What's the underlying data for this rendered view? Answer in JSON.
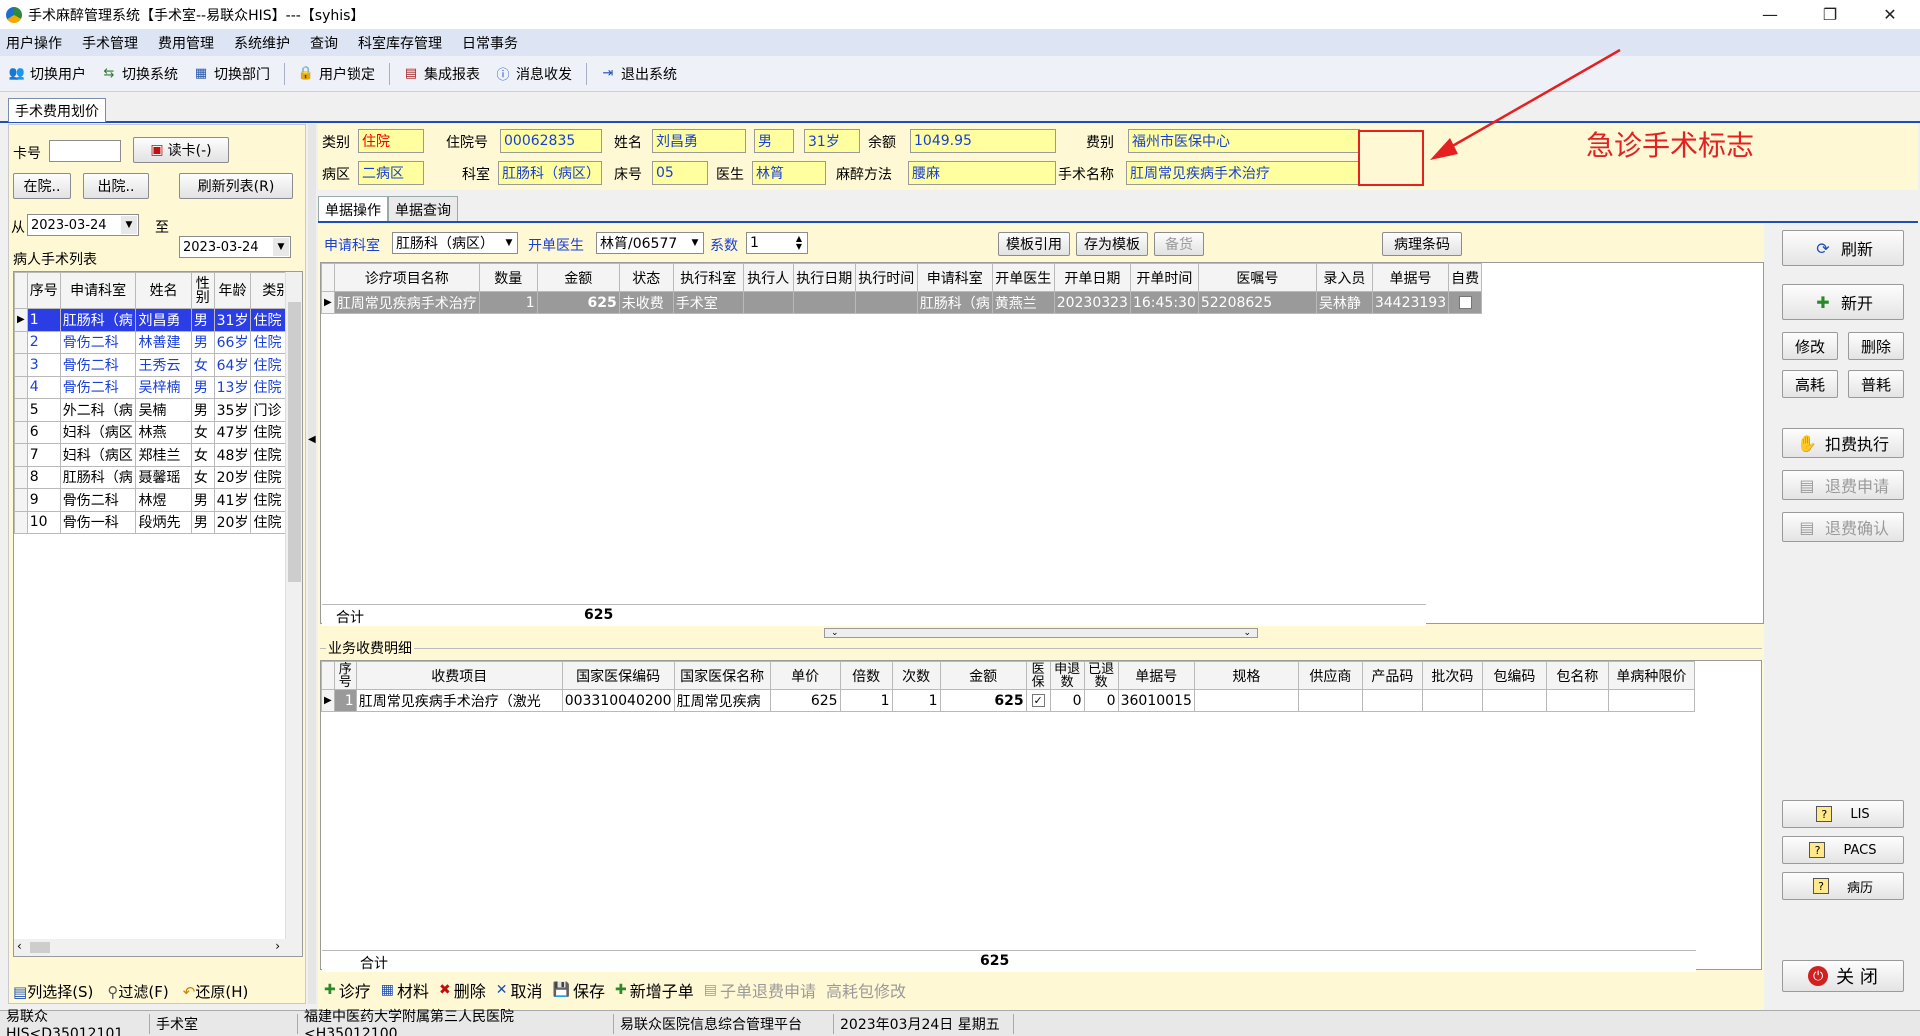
{
  "window": {
    "title": "手术麻醉管理系统【手术室--易联众HIS】---【syhis】",
    "controls": [
      "—",
      "❐",
      "✕"
    ]
  },
  "menu": [
    "用户操作",
    "手术管理",
    "费用管理",
    "系统维护",
    "查询",
    "科室库存管理",
    "日常事务"
  ],
  "toolbar": [
    {
      "label": "切换用户",
      "icon": "users-icon"
    },
    {
      "label": "切换系统",
      "icon": "switch-icon"
    },
    {
      "label": "切换部门",
      "icon": "department-icon"
    },
    {
      "label": "用户锁定",
      "icon": "lock-user-icon"
    },
    {
      "label": "集成报表",
      "icon": "report-icon"
    },
    {
      "label": "消息收发",
      "icon": "info-icon"
    },
    {
      "label": "退出系统",
      "icon": "exit-icon"
    }
  ],
  "module_tab": "手术费用划价",
  "left": {
    "card_label": "卡号",
    "card_value": "",
    "read_card": "读卡(-)",
    "btn_inhosp": "在院..",
    "btn_discharged": "出院..",
    "btn_refresh_list": "刷新列表(R)",
    "from_label": "从",
    "to_label": "至",
    "date_from": "2023-03-24",
    "date_to": "2023-03-24",
    "list_title": "病人手术列表",
    "columns": [
      "序号",
      "申请科室",
      "姓名",
      "性别",
      "年龄",
      "类别"
    ],
    "rows": [
      [
        "1",
        "肛肠科（病",
        "刘昌勇",
        "男",
        "31岁",
        "住院"
      ],
      [
        "2",
        "骨伤二科",
        "林善建",
        "男",
        "66岁",
        "住院"
      ],
      [
        "3",
        "骨伤二科",
        "王秀云",
        "女",
        "64岁",
        "住院"
      ],
      [
        "4",
        "骨伤二科",
        "吴梓楠",
        "男",
        "13岁",
        "住院"
      ],
      [
        "5",
        "外二科（病",
        "吴楠",
        "男",
        "35岁",
        "门诊"
      ],
      [
        "6",
        "妇科（病区",
        "林燕",
        "女",
        "47岁",
        "住院"
      ],
      [
        "7",
        "妇科（病区",
        "郑桂兰",
        "女",
        "48岁",
        "住院"
      ],
      [
        "8",
        "肛肠科（病",
        "聂馨瑶",
        "女",
        "20岁",
        "住院"
      ],
      [
        "9",
        "骨伤二科",
        "林煜",
        "男",
        "41岁",
        "住院"
      ],
      [
        "10",
        "骨伤一科",
        "段炳先",
        "男",
        "20岁",
        "住院"
      ]
    ],
    "blue_rows": [
      1,
      2,
      3
    ],
    "bottom_actions": [
      "列选择(S)",
      "过滤(F)",
      "还原(H)"
    ]
  },
  "header": {
    "类别": "住院",
    "住院号": "00062835",
    "姓名": "刘昌勇",
    "性别": "男",
    "年龄": "31岁",
    "余额": "1049.95",
    "费别": "福州市医保中心",
    "病区": "二病区",
    "科室": "肛肠科（病区）",
    "床号": "05",
    "医生": "林筲",
    "麻醉方法": "腰麻",
    "手术名称": "肛周常见疾病手术治疗",
    "labels": {
      "cat": "类别",
      "inhosp": "住院号",
      "name": "姓名",
      "balance": "余额",
      "feetype": "费别",
      "ward": "病区",
      "dept": "科室",
      "bed": "床号",
      "doctor": "医生",
      "anes": "麻醉方法",
      "opname": "手术名称"
    },
    "annotation": "急诊手术标志"
  },
  "subtabs": [
    "单据操作",
    "单据查询"
  ],
  "order_bar": {
    "dept_label": "申请科室",
    "dept_value": "肛肠科（病区）",
    "doctor_label": "开单医生",
    "doctor_value": "林筲/06577",
    "factor_label": "系数",
    "factor_value": "1",
    "btn_template_ref": "模板引用",
    "btn_save_template": "存为模板",
    "btn_backup": "备货",
    "btn_pathology": "病理条码"
  },
  "upper_grid": {
    "columns": [
      "诊疗项目名称",
      "数量",
      "金额",
      "状态",
      "执行科室",
      "执行人",
      "执行日期",
      "执行时间",
      "申请科室",
      "开单医生",
      "开单日期",
      "开单时间",
      "医嘱号",
      "录入员",
      "单据号",
      "自费"
    ],
    "rows": [
      [
        "肛周常见疾病手术治疗",
        "1",
        "625",
        "未收费",
        "手术室",
        "",
        "",
        "",
        "肛肠科（病",
        "黄燕兰",
        "20230323",
        "16:45:30",
        "52208625",
        "吴林静",
        "34423193",
        ""
      ]
    ],
    "sum_label": "合计",
    "sum_value": "625"
  },
  "detail_title": "业务收费明细",
  "lower_grid": {
    "columns": [
      "序号",
      "收费项目",
      "国家医保编码",
      "国家医保名称",
      "单价",
      "倍数",
      "次数",
      "金额",
      "医保",
      "申退数",
      "已退数",
      "单据号",
      "规格",
      "供应商",
      "产品码",
      "批次码",
      "包编码",
      "包名称",
      "单病种限价"
    ],
    "rows": [
      [
        "1",
        "肛周常见疾病手术治疗（激光",
        "003310040200",
        "肛周常见疾病",
        "625",
        "1",
        "1",
        "625",
        "✓",
        "0",
        "0",
        "36010015",
        "",
        "",
        "",
        "",
        "",
        "",
        ""
      ]
    ],
    "sum_label": "合计",
    "sum_value": "625"
  },
  "bottom_actions": [
    {
      "label": "诊疗",
      "enabled": true,
      "icon": "plus-icon"
    },
    {
      "label": "材料",
      "enabled": true,
      "icon": "material-icon"
    },
    {
      "label": "删除",
      "enabled": true,
      "icon": "delete-icon"
    },
    {
      "label": "取消",
      "enabled": true,
      "icon": "cancel-icon"
    },
    {
      "label": "保存",
      "enabled": true,
      "icon": "save-icon"
    },
    {
      "label": "新增子单",
      "enabled": true,
      "icon": "add-sub-icon"
    },
    {
      "label": "子单退费申请",
      "enabled": false,
      "icon": "refund-icon"
    },
    {
      "label": "高耗包修改",
      "enabled": false,
      "icon": ""
    }
  ],
  "right_buttons": {
    "refresh": "刷新",
    "new": "新开",
    "modify": "修改",
    "delete": "删除",
    "high_cost": "高耗",
    "normal_cost": "普耗",
    "charge_exec": "扣费执行",
    "refund_apply": "退费申请",
    "refund_confirm": "退费确认",
    "lis": "LIS",
    "pacs": "PACS",
    "emr": "病历",
    "close": "关 闭"
  },
  "status": [
    "易联众HIS<D35012101",
    "手术室",
    "福建中医药大学附属第三人民医院<H35012100",
    "易联众医院信息综合管理平台",
    "2023年03月24日 星期五"
  ],
  "colors": {
    "accent": "#1e4fb4",
    "panel": "#fff8d4",
    "field": "#ffffa0",
    "selection": "#2b3ee6",
    "annotation": "#e52020"
  }
}
